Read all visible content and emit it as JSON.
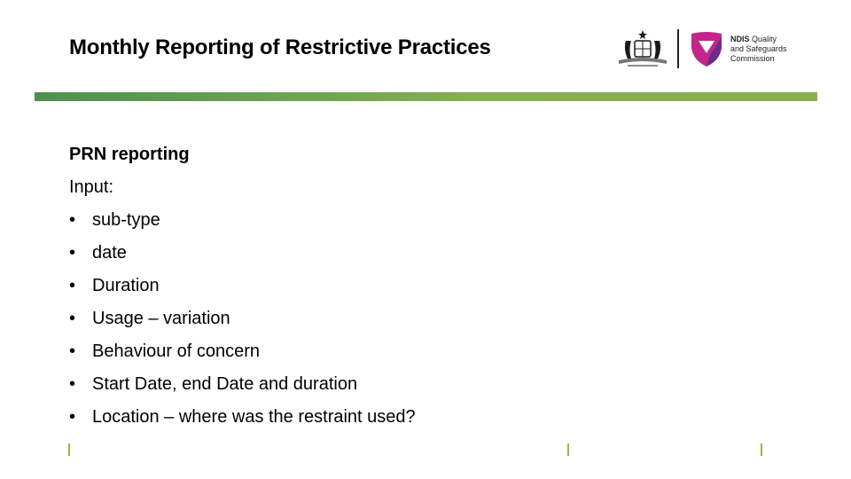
{
  "slide": {
    "title": "Monthly Reporting of Restrictive Practices",
    "logos": {
      "government_crest": "australian-government-crest-icon",
      "ndis_line1_bold": "NDIS",
      "ndis_line1_rest": " Quality",
      "ndis_line2": "and Safeguards",
      "ndis_line3": "Commission"
    },
    "colors": {
      "accent_green": "#88ae52",
      "accent_green_dark": "#4f9050",
      "brand_magenta": "#c2268a",
      "brand_purple": "#6b2b8a",
      "footer_mark": "#8cbd49"
    },
    "section_heading": "PRN reporting",
    "intro_label": "Input:",
    "bullet_glyph": "•",
    "bullets": [
      "sub-type",
      "date",
      "Duration",
      "Usage – variation",
      "Behaviour of concern",
      "Start Date, end Date and duration",
      "Location – where was the restraint used?"
    ]
  }
}
